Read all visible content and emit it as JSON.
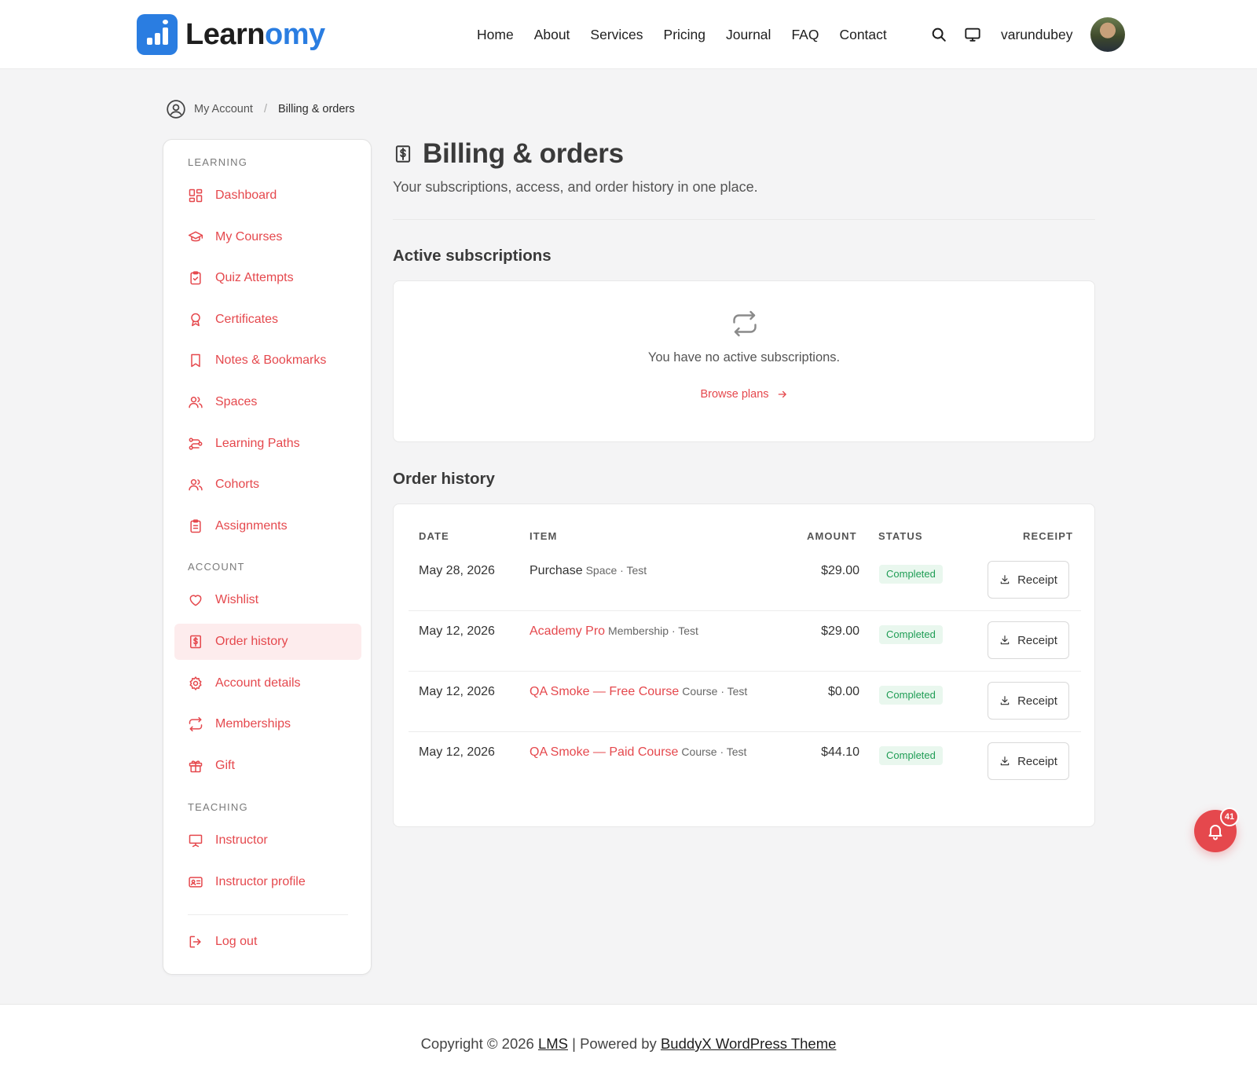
{
  "brand": {
    "name_dark": "Learn",
    "name_accent": "omy",
    "accent_color": "#2a7de1",
    "primary_color": "#e5484d"
  },
  "nav": [
    "Home",
    "About",
    "Services",
    "Pricing",
    "Journal",
    "FAQ",
    "Contact"
  ],
  "header": {
    "username": "varundubey",
    "search_icon": "search-icon",
    "display_icon": "monitor-icon"
  },
  "breadcrumb": {
    "root": "My Account",
    "separator": "/",
    "current": "Billing & orders"
  },
  "sidebar": {
    "sections": {
      "learning": "LEARNING",
      "account": "ACCOUNT",
      "teaching": "TEACHING"
    },
    "learning_items": [
      {
        "label": "Dashboard",
        "icon": "dashboard-icon"
      },
      {
        "label": "My Courses",
        "icon": "graduation-cap-icon"
      },
      {
        "label": "Quiz Attempts",
        "icon": "clipboard-check-icon"
      },
      {
        "label": "Certificates",
        "icon": "award-icon"
      },
      {
        "label": "Notes & Bookmarks",
        "icon": "bookmark-icon"
      },
      {
        "label": "Spaces",
        "icon": "users-icon"
      },
      {
        "label": "Learning Paths",
        "icon": "route-icon"
      },
      {
        "label": "Cohorts",
        "icon": "users-icon"
      },
      {
        "label": "Assignments",
        "icon": "clipboard-list-icon"
      }
    ],
    "account_items": [
      {
        "label": "Wishlist",
        "icon": "heart-icon"
      },
      {
        "label": "Order history",
        "icon": "receipt-icon",
        "active": true
      },
      {
        "label": "Account details",
        "icon": "gear-icon"
      },
      {
        "label": "Memberships",
        "icon": "repeat-icon"
      },
      {
        "label": "Gift",
        "icon": "gift-icon"
      }
    ],
    "teaching_items": [
      {
        "label": "Instructor",
        "icon": "presentation-icon"
      },
      {
        "label": "Instructor profile",
        "icon": "id-card-icon"
      }
    ],
    "logout": "Log out"
  },
  "main": {
    "title": "Billing & orders",
    "subtitle": "Your subscriptions, access, and order history in one place.",
    "subscriptions": {
      "heading": "Active subscriptions",
      "empty_text": "You have no active subscriptions.",
      "browse_label": "Browse plans"
    },
    "orders": {
      "heading": "Order history",
      "columns": {
        "date": "DATE",
        "item": "ITEM",
        "amount": "AMOUNT",
        "status": "STATUS",
        "receipt": "RECEIPT"
      },
      "receipt_label": "Receipt",
      "rows": [
        {
          "date": "May 28, 2026",
          "item": "Purchase",
          "item_link": false,
          "meta": "Space · Test",
          "amount": "$29.00",
          "status": "Completed"
        },
        {
          "date": "May 12, 2026",
          "item": "Academy Pro",
          "item_link": true,
          "meta": "Membership · Test",
          "amount": "$29.00",
          "status": "Completed"
        },
        {
          "date": "May 12, 2026",
          "item": "QA Smoke — Free Course",
          "item_link": true,
          "meta": "Course · Test",
          "amount": "$0.00",
          "status": "Completed"
        },
        {
          "date": "May 12, 2026",
          "item": "QA Smoke — Paid Course",
          "item_link": true,
          "meta": "Course · Test",
          "amount": "$44.10",
          "status": "Completed"
        }
      ]
    }
  },
  "notifications": {
    "count": "41"
  },
  "footer": {
    "prefix": "Copyright © 2026",
    "site_link": "LMS",
    "divider": "|",
    "powered_by": "Powered by",
    "theme_link": "BuddyX WordPress Theme"
  }
}
